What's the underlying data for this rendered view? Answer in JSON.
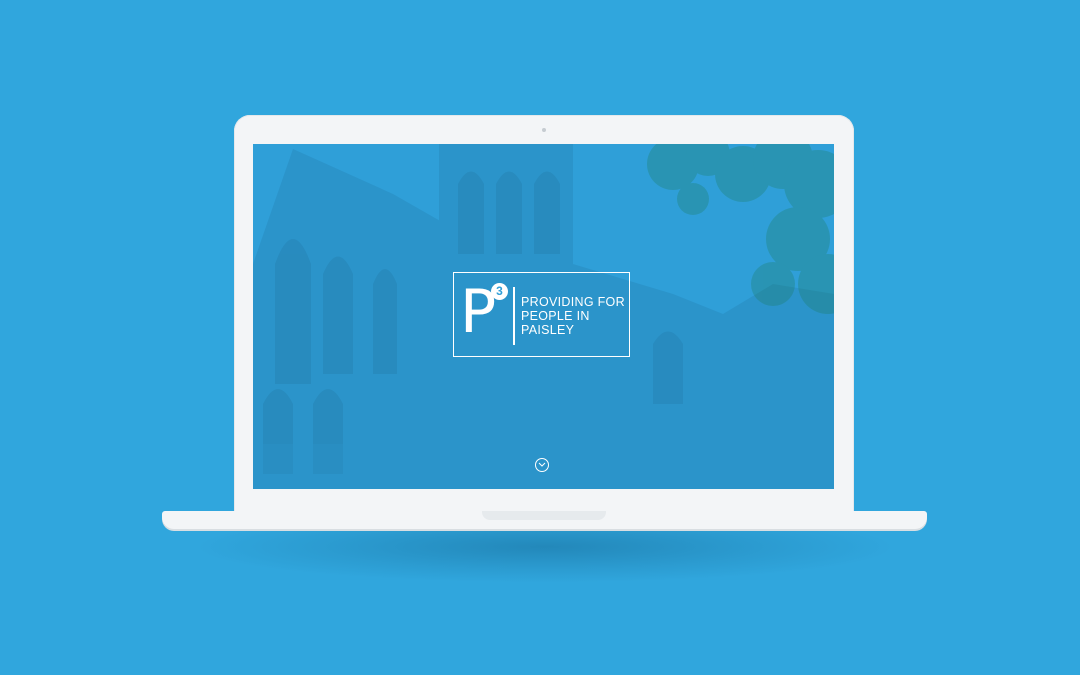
{
  "logo": {
    "mark": "P",
    "superscript": "3",
    "lines": [
      "PROVIDING FOR",
      "PEOPLE IN",
      "PAISLEY"
    ]
  },
  "scroll_button": {
    "icon": "chevron-down-icon"
  },
  "colors": {
    "background": "#30a6dd",
    "screen_overlay": "#2f9fd8",
    "laptop_body": "#f3f5f7",
    "logo": "#ffffff"
  }
}
